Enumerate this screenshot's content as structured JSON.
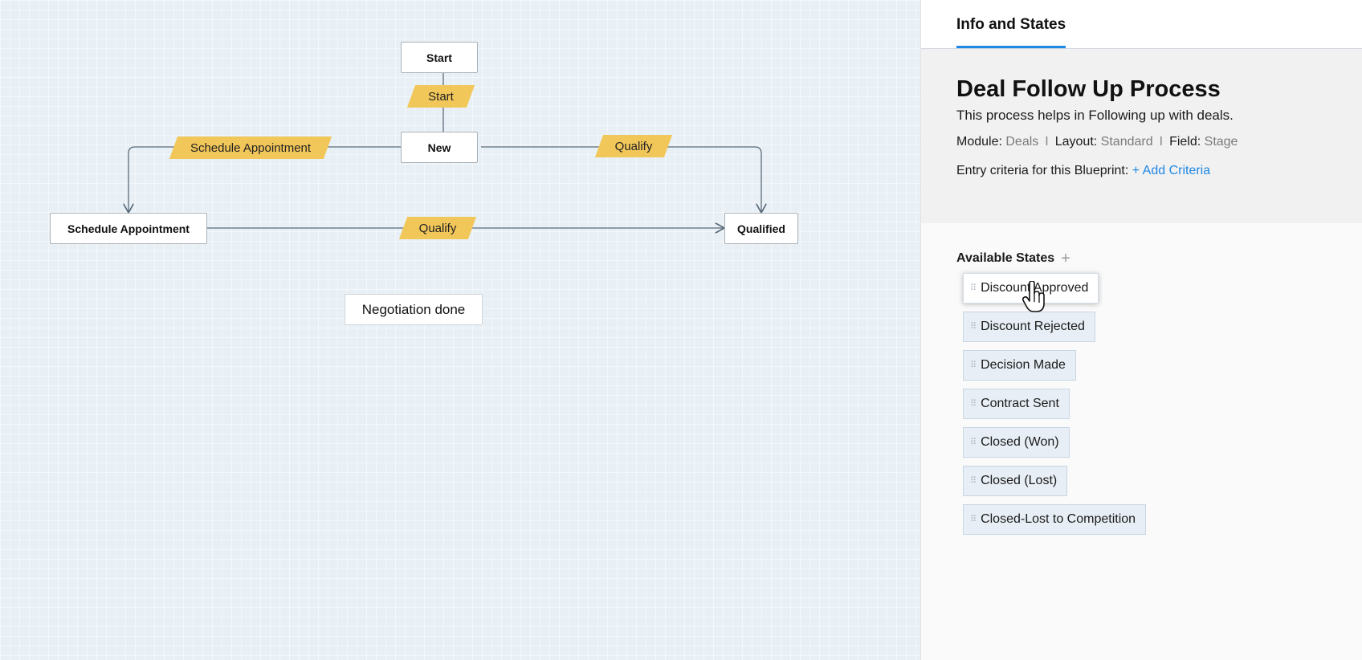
{
  "canvas": {
    "states": {
      "start": "Start",
      "new": "New",
      "schedule_appointment": "Schedule Appointment",
      "qualified": "Qualified",
      "negotiation_done": "Negotiation done"
    },
    "transitions": {
      "start": "Start",
      "schedule_appointment": "Schedule Appointment",
      "qualify_top": "Qualify",
      "qualify_bottom": "Qualify"
    },
    "colors": {
      "transition_fill": "#f2c75a",
      "connector": "#5a6a78"
    }
  },
  "panel": {
    "tab_label": "Info and States",
    "title": "Deal Follow Up Process",
    "description": "This process helps in Following up with deals.",
    "module_label": "Module:",
    "module_value": "Deals",
    "layout_label": "Layout:",
    "layout_value": "Standard",
    "field_label": "Field:",
    "field_value": "Stage",
    "separator": "I",
    "criteria_label": "Entry criteria for this Blueprint:",
    "add_criteria": "+ Add Criteria",
    "available_states_heading": "Available States",
    "add_icon": "+",
    "available_states": [
      "Discount Approved",
      "Discount Rejected",
      "Decision Made",
      "Contract Sent",
      "Closed (Won)",
      "Closed (Lost)",
      "Closed-Lost to Competition"
    ],
    "accent_color": "#1e88e5"
  },
  "icons": {
    "grip": "drag-handle-icon",
    "cursor": "hand-pointer-icon"
  }
}
